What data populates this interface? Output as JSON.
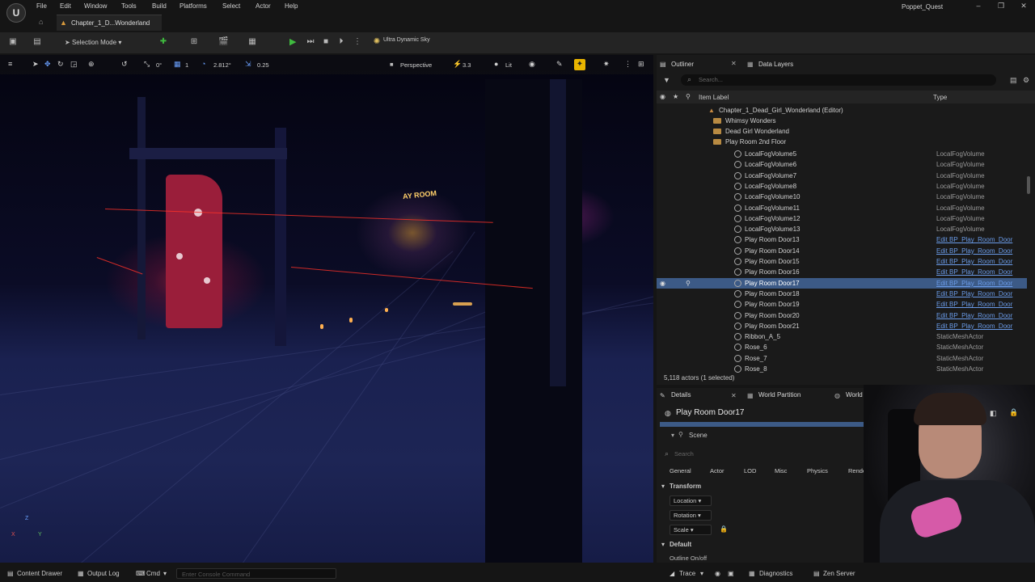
{
  "menubar": {
    "logo": "U",
    "items": [
      "File",
      "Edit",
      "Window",
      "Tools",
      "Build",
      "Platforms",
      "Select",
      "Actor",
      "Help"
    ],
    "project_name": "Poppet_Quest",
    "minimize": "–",
    "maximize": "❐",
    "close": "✕"
  },
  "tabs": {
    "level_tab": "Chapter_1_D...Wonderland"
  },
  "toolbar": {
    "selection_mode": "Selection Mode",
    "sky_label": "Ultra Dynamic Sky"
  },
  "viewport": {
    "grid_rotation": "0°",
    "grid_snap": "1",
    "rotation_snap": "2.812°",
    "scale_snap": "0.25",
    "perspective_label": "Perspective",
    "camera_speed": "3.3",
    "view_mode": "Lit",
    "sign_text": "AY ROOM",
    "axis_z": "Z",
    "axis_x": "X",
    "axis_y": "Y"
  },
  "outliner": {
    "tab_label": "Outliner",
    "data_layers_tab": "Data Layers",
    "search_placeholder": "Search...",
    "col_item_label": "Item Label",
    "col_type": "Type",
    "tree": [
      {
        "label": "Chapter_1_Dead_Girl_Wonderland (Editor)",
        "kind": "root",
        "type": ""
      },
      {
        "label": "Whimsy Wonders",
        "kind": "folder",
        "type": ""
      },
      {
        "label": "Dead Girl Wonderland",
        "kind": "folder",
        "type": ""
      },
      {
        "label": "Play Room 2nd Floor",
        "kind": "folder",
        "type": ""
      }
    ],
    "rows": [
      {
        "label": "LocalFogVolume5",
        "type": "LocalFogVolume",
        "link": false,
        "selected": false
      },
      {
        "label": "LocalFogVolume6",
        "type": "LocalFogVolume",
        "link": false,
        "selected": false
      },
      {
        "label": "LocalFogVolume7",
        "type": "LocalFogVolume",
        "link": false,
        "selected": false
      },
      {
        "label": "LocalFogVolume8",
        "type": "LocalFogVolume",
        "link": false,
        "selected": false
      },
      {
        "label": "LocalFogVolume10",
        "type": "LocalFogVolume",
        "link": false,
        "selected": false
      },
      {
        "label": "LocalFogVolume11",
        "type": "LocalFogVolume",
        "link": false,
        "selected": false
      },
      {
        "label": "LocalFogVolume12",
        "type": "LocalFogVolume",
        "link": false,
        "selected": false
      },
      {
        "label": "LocalFogVolume13",
        "type": "LocalFogVolume",
        "link": false,
        "selected": false
      },
      {
        "label": "Play Room Door13",
        "type": "Edit BP_Play_Room_Door",
        "link": true,
        "selected": false
      },
      {
        "label": "Play Room Door14",
        "type": "Edit BP_Play_Room_Door",
        "link": true,
        "selected": false
      },
      {
        "label": "Play Room Door15",
        "type": "Edit BP_Play_Room_Door",
        "link": true,
        "selected": false
      },
      {
        "label": "Play Room Door16",
        "type": "Edit BP_Play_Room_Door",
        "link": true,
        "selected": false
      },
      {
        "label": "Play Room Door17",
        "type": "Edit BP_Play_Room_Door",
        "link": true,
        "selected": true
      },
      {
        "label": "Play Room Door18",
        "type": "Edit BP_Play_Room_Door",
        "link": true,
        "selected": false
      },
      {
        "label": "Play Room Door19",
        "type": "Edit BP_Play_Room_Door",
        "link": true,
        "selected": false
      },
      {
        "label": "Play Room Door20",
        "type": "Edit BP_Play_Room_Door",
        "link": true,
        "selected": false
      },
      {
        "label": "Play Room Door21",
        "type": "Edit BP_Play_Room_Door",
        "link": true,
        "selected": false
      },
      {
        "label": "Ribbon_A_5",
        "type": "StaticMeshActor",
        "link": false,
        "selected": false
      },
      {
        "label": "Rose_6",
        "type": "StaticMeshActor",
        "link": false,
        "selected": false
      },
      {
        "label": "Rose_7",
        "type": "StaticMeshActor",
        "link": false,
        "selected": false
      },
      {
        "label": "Rose_8",
        "type": "StaticMeshActor",
        "link": false,
        "selected": false
      }
    ],
    "footer": "5,118 actors (1 selected)"
  },
  "details": {
    "tab_label": "Details",
    "world_partition_tab": "World Partition",
    "world_settings_tab": "World Settings",
    "actor_name": "Play Room Door17",
    "scene_label": "Scene",
    "search_placeholder": "Search",
    "categories": [
      "General",
      "Actor",
      "LOD",
      "Misc",
      "Physics",
      "Rendering"
    ],
    "transform_header": "Transform",
    "location": "Location",
    "rotation": "Rotation",
    "scale": "Scale",
    "default_header": "Default",
    "outline_prop": "Outline On/off"
  },
  "statusbar": {
    "content_drawer": "Content Drawer",
    "output_log": "Output Log",
    "cmd": "Cmd",
    "console_placeholder": "Enter Console Command",
    "trace": "Trace",
    "diagnostics": "Diagnostics",
    "zen_server": "Zen Server"
  },
  "colors": {
    "accent_selected": "#3c5a86",
    "play_green": "#3fbb3f",
    "link_blue": "#6a9be8",
    "folder": "#b88a42"
  }
}
